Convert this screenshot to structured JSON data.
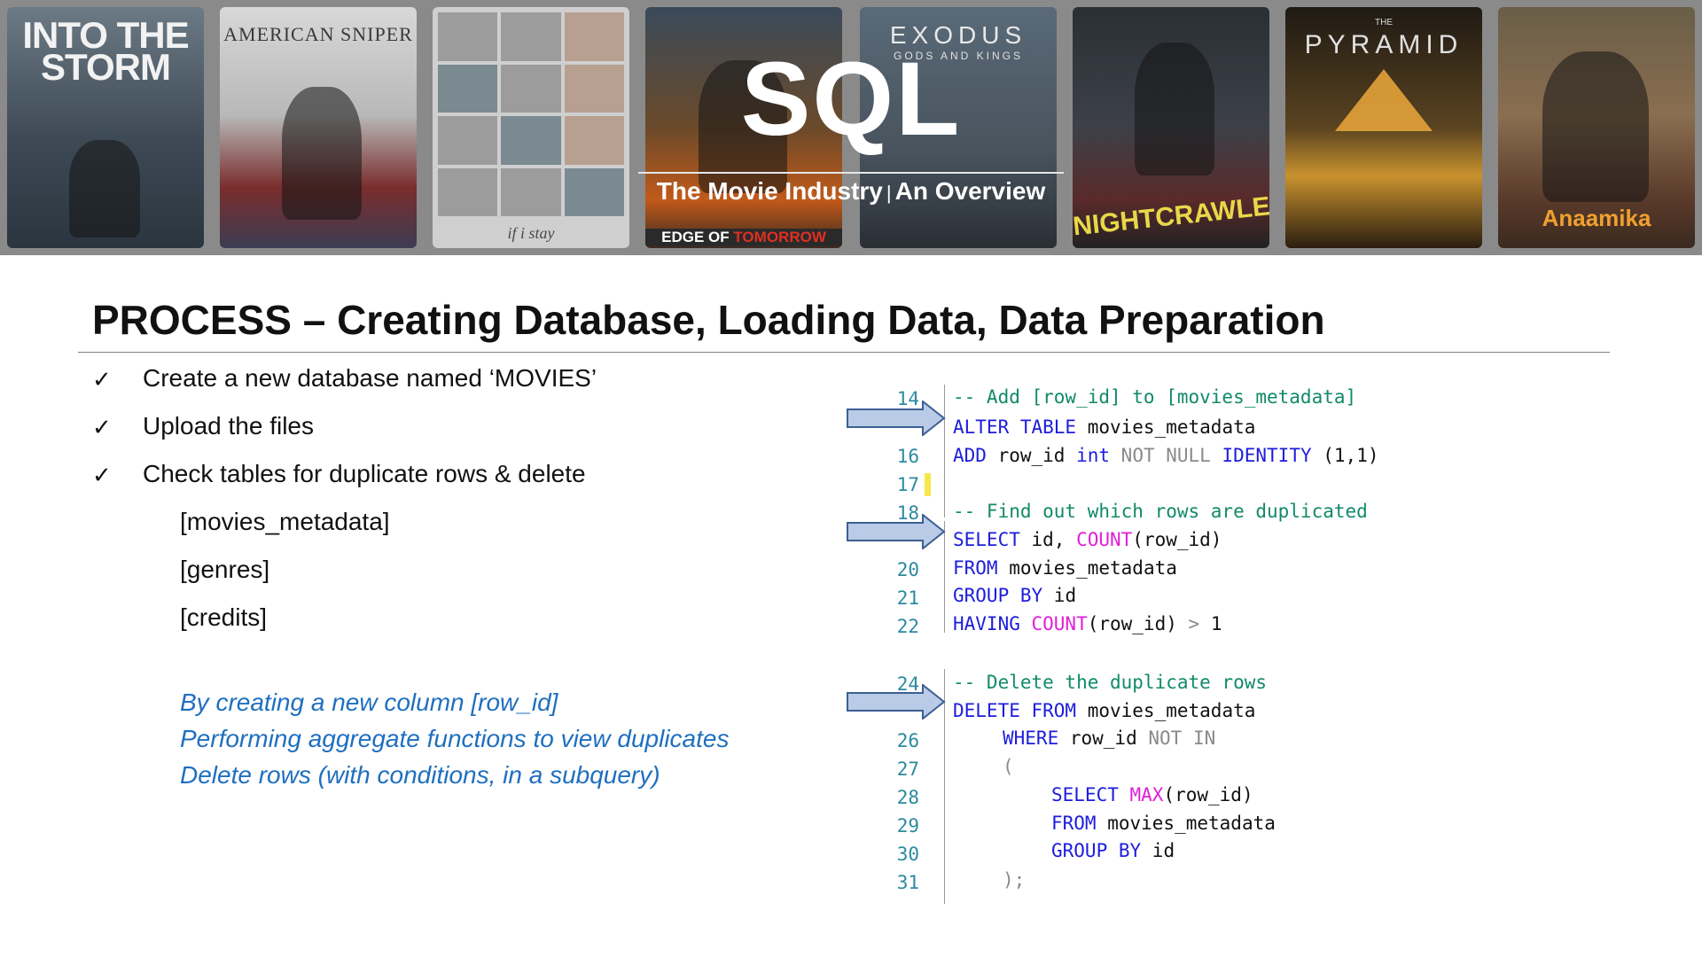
{
  "banner": {
    "posters": [
      {
        "title": "INTO THE STORM"
      },
      {
        "title": "AMERICAN SNIPER"
      },
      {
        "title": "if i stay"
      },
      {
        "title_a": "EDGE OF ",
        "title_b": "TOMORROW"
      },
      {
        "title": "EXODUS",
        "subtitle": "GODS AND KINGS"
      },
      {
        "title": "NIGHTCRAWLER"
      },
      {
        "title": "PYRAMID",
        "prefix": "THE"
      },
      {
        "title": "Anaamika"
      }
    ],
    "sql_title": "SQL",
    "subtitle_left": "The Movie Industry",
    "subtitle_sep": "|",
    "subtitle_right": "An Overview"
  },
  "heading": "PROCESS – Creating Database, Loading Data,  Data Preparation",
  "checklist": {
    "mark": "✓",
    "items": [
      "Create a new database named ‘MOVIES’",
      "Upload the files",
      "Check tables for duplicate rows & delete"
    ],
    "tables": [
      "[movies_metadata]",
      "[genres]",
      "[credits]"
    ],
    "notes": [
      "By creating a new column [row_id]",
      "Performing aggregate functions to view duplicates",
      "Delete rows (with conditions, in a subquery)"
    ]
  },
  "code": {
    "line_numbers": [
      "14",
      "16",
      "17",
      "18",
      "20",
      "21",
      "22",
      "24",
      "26",
      "27",
      "28",
      "29",
      "30",
      "31"
    ],
    "l14": "-- Add [row_id] to [movies_metadata]",
    "l15": {
      "k1": "ALTER TABLE",
      "t": " movies_metadata"
    },
    "l16": {
      "k1": "ADD",
      "t1": " row_id ",
      "k2": "int",
      "g": " NOT NULL ",
      "k3": "IDENTITY",
      "t2": " (1,1)"
    },
    "l18": "-- Find out which rows are duplicated",
    "l19": {
      "k1": "SELECT",
      "t1": " id, ",
      "f": "COUNT",
      "t2": "(row_id)"
    },
    "l20": {
      "k1": "FROM",
      "t": " movies_metadata"
    },
    "l21": {
      "k1": "GROUP BY",
      "t": " id"
    },
    "l22": {
      "k1": "HAVING",
      "f": " COUNT",
      "t1": "(row_id) ",
      "g": ">",
      "t2": " 1"
    },
    "l24": "-- Delete the duplicate rows",
    "l25": {
      "k1": "DELETE FROM",
      "t": " movies_metadata"
    },
    "l26": {
      "k1": "WHERE",
      "t": " row_id ",
      "g": "NOT IN"
    },
    "l27": "(",
    "l28": {
      "k1": "SELECT",
      "f": " MAX",
      "t": "(row_id)"
    },
    "l29": {
      "k1": "FROM",
      "t": " movies_metadata"
    },
    "l30": {
      "k1": "GROUP BY",
      "t": " id"
    },
    "l31": ");"
  },
  "colors": {
    "keyword": "#1d1ddb",
    "function": "#e020d8",
    "comment": "#118a68",
    "line_number": "#2b8aa0",
    "note_text": "#1f6fbf",
    "arrow_fill": "#b9cbe6",
    "arrow_stroke": "#3b5f94"
  }
}
